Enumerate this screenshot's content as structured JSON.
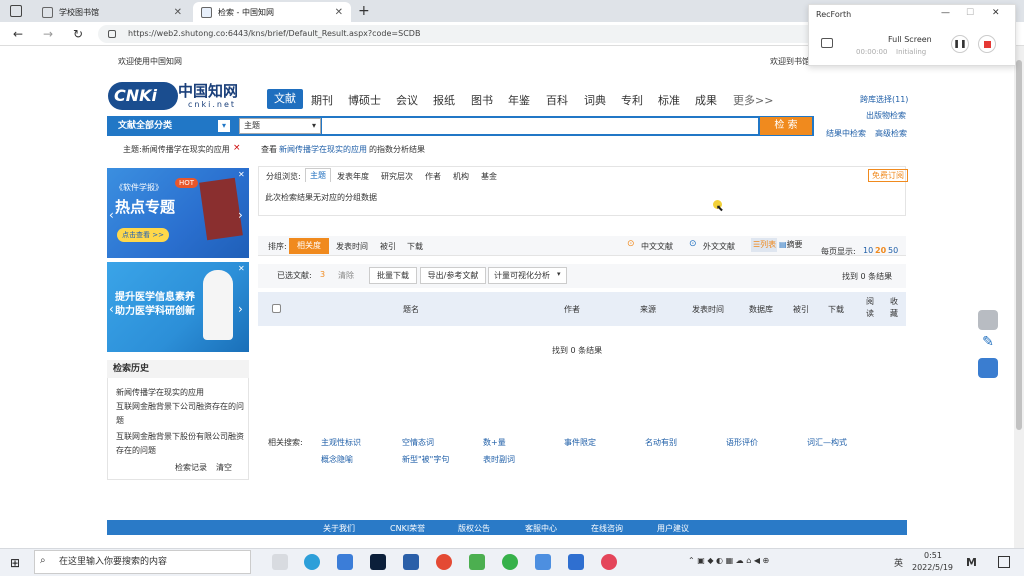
{
  "browser": {
    "tabs": [
      {
        "label": "学校图书馆"
      },
      {
        "label": "检索 - 中国知网"
      }
    ],
    "url": "https://web2.shutong.co:6443/kns/brief/Default_Result.aspx?code=SCDB"
  },
  "site": {
    "welcome": "欢迎使用中国知网",
    "welcome_right": "欢迎到书馆",
    "logo_text": "中国知网",
    "logo_sub": "cnki.net",
    "nav": [
      "文献",
      "期刊",
      "博硕士",
      "会议",
      "报纸",
      "图书",
      "年鉴",
      "百科",
      "词典",
      "专利",
      "标准",
      "成果",
      "更多>>"
    ],
    "right_links": [
      "跨库选择(11)",
      "出版物检索",
      "结果中检索",
      "高级检索"
    ],
    "search_category": "文献全部分类",
    "search_field": "主题",
    "search_button": "检 索",
    "topic_tag": "主题:新闻传播学在现实的应用",
    "analysis_prefix": "查看",
    "analysis_topic": "新闻传播学在现实的应用",
    "analysis_suffix": "的指数分析结果",
    "group_label": "分组浏览:",
    "group_tabs": [
      "主题",
      "发表年度",
      "研究层次",
      "作者",
      "机构",
      "基金"
    ],
    "free_sub": "免费订阅",
    "group_empty": "此次检索结果无对应的分组数据",
    "sort_label": "排序:",
    "sort_items": [
      "相关度",
      "发表时间",
      "被引",
      "下载"
    ],
    "lang_cn": "中文文献",
    "lang_en": "外文文献",
    "view_list": "列表",
    "view_abstract": "摘要",
    "per_page_label": "每页显示:",
    "per_page": [
      "10",
      "20",
      "50"
    ],
    "selected_label": "已选文献:",
    "selected_count": "3",
    "clear": "清除",
    "batch_download": "批量下载",
    "export": "导出/参考文献",
    "visual": "计量可视化分析",
    "found_count": "找到 0 条结果",
    "cols": [
      "题名",
      "作者",
      "来源",
      "发表时间",
      "数据库",
      "被引",
      "下载",
      "阅读",
      "收藏"
    ],
    "no_result": "找到 0 条结果",
    "related_label": "相关搜索:",
    "related": [
      "主观性标识",
      "空情态词",
      "数+量",
      "事件限定",
      "名动有别",
      "语形评价",
      "词汇—构式",
      "概念隐喻",
      "新型\"被\"字句",
      "表时副词"
    ],
    "history_title": "检索历史",
    "history": [
      "新闻传播学在现实的应用",
      "互联网金融背景下公司融资存在的问题",
      "互联网金融背景下股份有限公司融资存在的问题"
    ],
    "history_actions": [
      "检索记录",
      "清空"
    ],
    "footer": [
      "关于我们",
      "CNKI荣誉",
      "版权公告",
      "客服中心",
      "在线咨询",
      "用户建议"
    ],
    "banner1_title": "热点专题",
    "banner1_sub": "《软件学报》",
    "banner1_btn": "点击查看 >>",
    "banner1_hot": "HOT",
    "banner2_title": "提升医学信息素养",
    "banner2_title2": "助力医学科研创新"
  },
  "recorder": {
    "app": "RecForth",
    "mode": "Full Screen",
    "time": "00:00:00",
    "status": "Initialing"
  },
  "taskbar": {
    "search_placeholder": "在这里输入你要搜索的内容",
    "time": "0:51",
    "date": "2022/5/19",
    "lang": "英"
  },
  "colors": {
    "accent": "#1f6fbf",
    "orange": "#f08a1e"
  }
}
